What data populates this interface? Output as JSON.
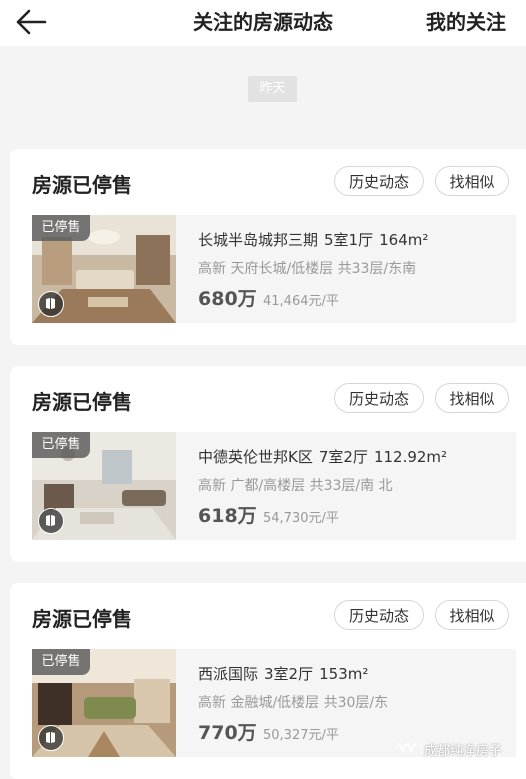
{
  "header": {
    "title": "关注的房源动态",
    "right_tab": "我的关注"
  },
  "date_chip": "昨天",
  "cards": [
    {
      "title": "房源已停售",
      "history_label": "历史动态",
      "similar_label": "找相似",
      "status_tag": "已停售",
      "name": "长城半岛城邦三期",
      "layout": "5室1厅",
      "area": "164m²",
      "details": "高新 天府长城/低楼层 共33层/东南",
      "price": "680万",
      "unit_price": "41,464元/平"
    },
    {
      "title": "房源已停售",
      "history_label": "历史动态",
      "similar_label": "找相似",
      "status_tag": "已停售",
      "name": "中德英伦世邦K区",
      "layout": "7室2厅",
      "area": "112.92m²",
      "details": "高新 广都/高楼层 共33层/南 北",
      "price": "618万",
      "unit_price": "54,730元/平"
    },
    {
      "title": "房源已停售",
      "history_label": "历史动态",
      "similar_label": "找相似",
      "status_tag": "已停售",
      "name": "西派国际",
      "layout": "3室2厅",
      "area": "153m²",
      "details": "高新 金融城/低楼层 共30层/东",
      "price": "770万",
      "unit_price": "50,327元/平"
    }
  ],
  "watermark": "成都纯净房子",
  "icons": {
    "back": "back-arrow-icon",
    "vr": "vr-icon",
    "watermark": "wechat-channel-icon"
  }
}
